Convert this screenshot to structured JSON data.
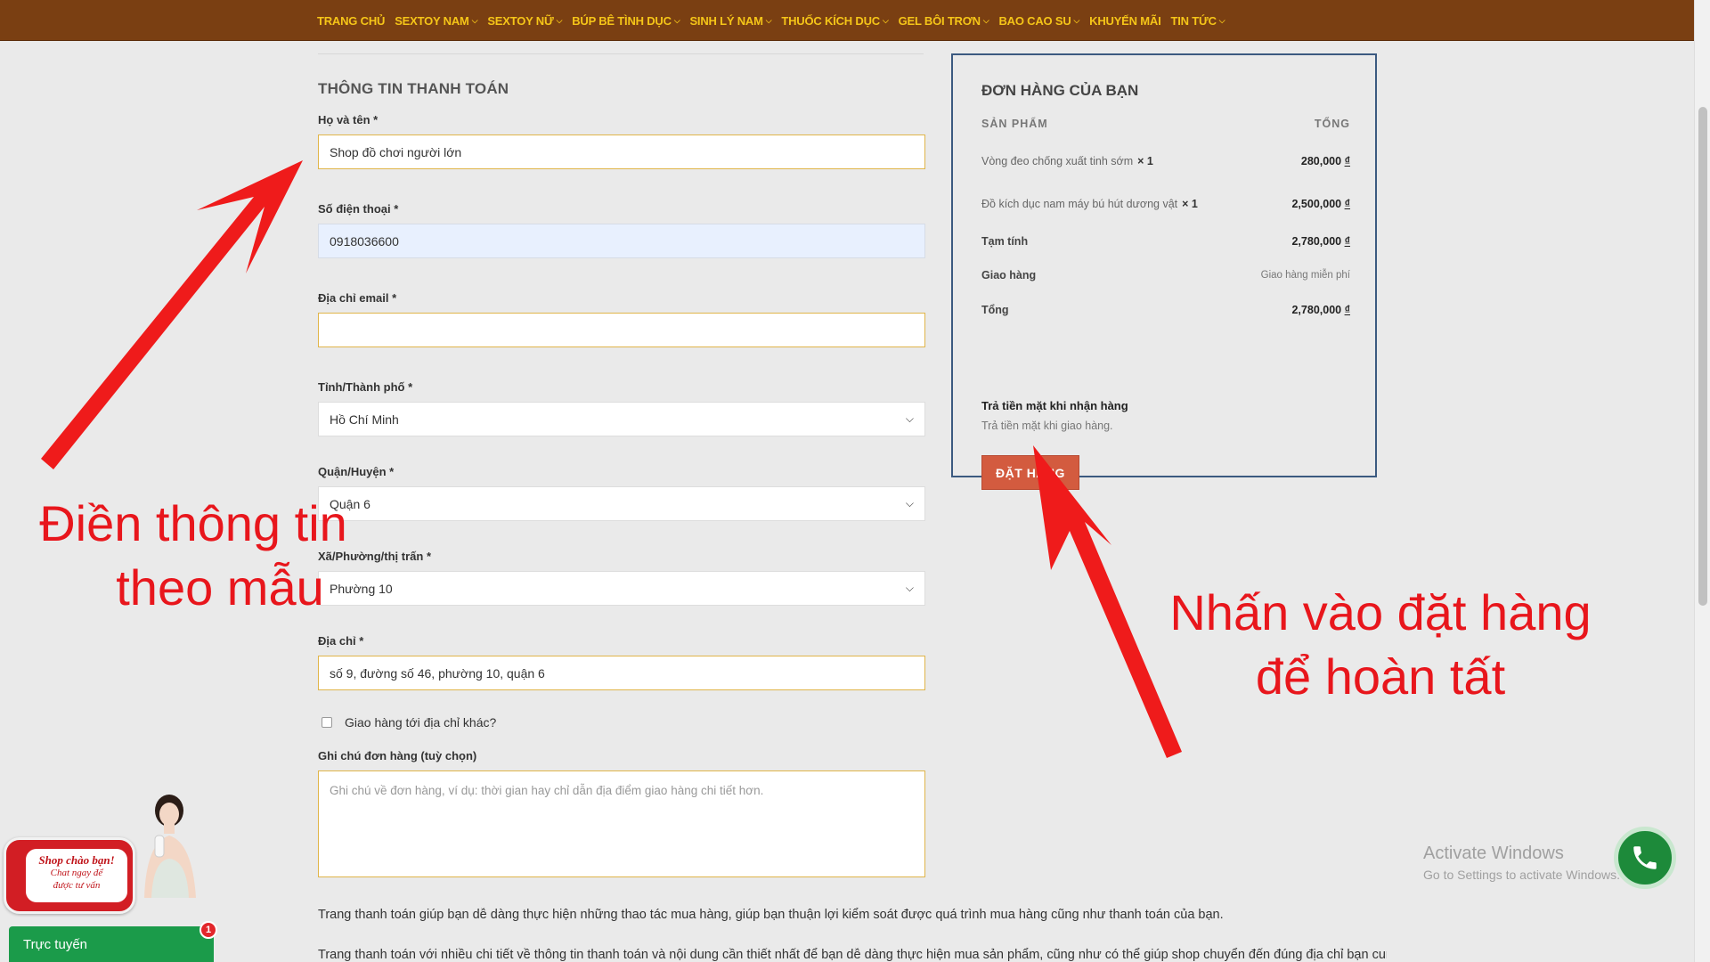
{
  "nav": {
    "items": [
      {
        "label": "TRANG CHỦ",
        "dropdown": false
      },
      {
        "label": "SEXTOY NAM",
        "dropdown": true
      },
      {
        "label": "SEXTOY NỮ",
        "dropdown": true
      },
      {
        "label": "BÚP BÊ TÌNH DỤC",
        "dropdown": true
      },
      {
        "label": "SINH LÝ NAM",
        "dropdown": true
      },
      {
        "label": "THUỐC KÍCH DỤC",
        "dropdown": true
      },
      {
        "label": "GEL BÔI TRƠN",
        "dropdown": true
      },
      {
        "label": "BAO CAO SU",
        "dropdown": true
      },
      {
        "label": "KHUYẾN MÃI",
        "dropdown": false
      },
      {
        "label": "TIN TỨC",
        "dropdown": true
      }
    ],
    "bg_color": "#7a3f12",
    "text_color": "#f5c518"
  },
  "billing": {
    "title": "THÔNG TIN THANH TOÁN",
    "name_label": "Họ và tên *",
    "name_value": "Shop đồ chơi người lớn",
    "phone_label": "Số điện thoại *",
    "phone_value": "0918036600",
    "email_label": "Địa chỉ email *",
    "email_value": "",
    "province_label": "Tỉnh/Thành phố *",
    "province_value": "Hồ Chí Minh",
    "district_label": "Quận/Huyện *",
    "district_value": "Quận 6",
    "ward_label": "Xã/Phường/thị trấn *",
    "ward_value": "Phường 10",
    "address_label": "Địa chỉ *",
    "address_value": "số 9, đường số 46, phường 10, quận 6",
    "ship_other_label": "Giao hàng tới địa chỉ khác?",
    "notes_label": "Ghi chú đơn hàng (tuỳ chọn)",
    "notes_placeholder": "Ghi chú về đơn hàng, ví dụ: thời gian hay chỉ dẫn địa điểm giao hàng chi tiết hơn."
  },
  "order": {
    "title": "ĐƠN HÀNG CỦA BẠN",
    "col_product": "SẢN PHẨM",
    "col_total": "TỔNG",
    "items": [
      {
        "name": "Vòng đeo chống xuất tinh sớm",
        "qty": "× 1",
        "price": "280,000",
        "currency": "₫"
      },
      {
        "name": "Đồ kích dục nam máy bú hút dương vật",
        "qty": "× 1",
        "price": "2,500,000",
        "currency": "₫"
      }
    ],
    "subtotal_label": "Tạm tính",
    "subtotal_value": "2,780,000",
    "shipping_label": "Giao hàng",
    "shipping_value": "Giao hàng miễn phí",
    "total_label": "Tổng",
    "total_value": "2,780,000",
    "currency": "₫",
    "payment_title": "Trả tiền mặt khi nhận hàng",
    "payment_desc": "Trả tiền mặt khi giao hàng.",
    "place_order_label": "ĐẶT HÀNG",
    "border_color": "#3c5a80",
    "button_color": "#d35b3f"
  },
  "paragraphs": [
    "Trang thanh toán giúp bạn dễ dàng thực hiện những thao tác mua hàng, giúp bạn thuận lợi kiểm soát được quá trình mua hàng cũng như thanh toán của bạn.",
    "Trang thanh toán với nhiều chi tiết về thông tin thanh toán và nội dung cần thiết nhất để bạn dễ dàng thực hiện mua sản phẩm, cũng như có thể giúp shop chuyển đến đúng địa chỉ bạn cung"
  ],
  "annotations": {
    "left_line1": "Điền thông tin",
    "left_line2": "theo mẫu",
    "right_line1": "Nhấn vào đặt hàng",
    "right_line2": "để hoàn tất",
    "color": "#e8161c"
  },
  "chat": {
    "bubble_line1": "Shop chào bạn!",
    "bubble_line2": "Chat ngay để",
    "bubble_line3": "được tư vấn",
    "bar_label": "Trực tuyến",
    "badge": "1"
  },
  "watermark": {
    "line1": "Activate Windows",
    "line2": "Go to Settings to activate Windows."
  }
}
